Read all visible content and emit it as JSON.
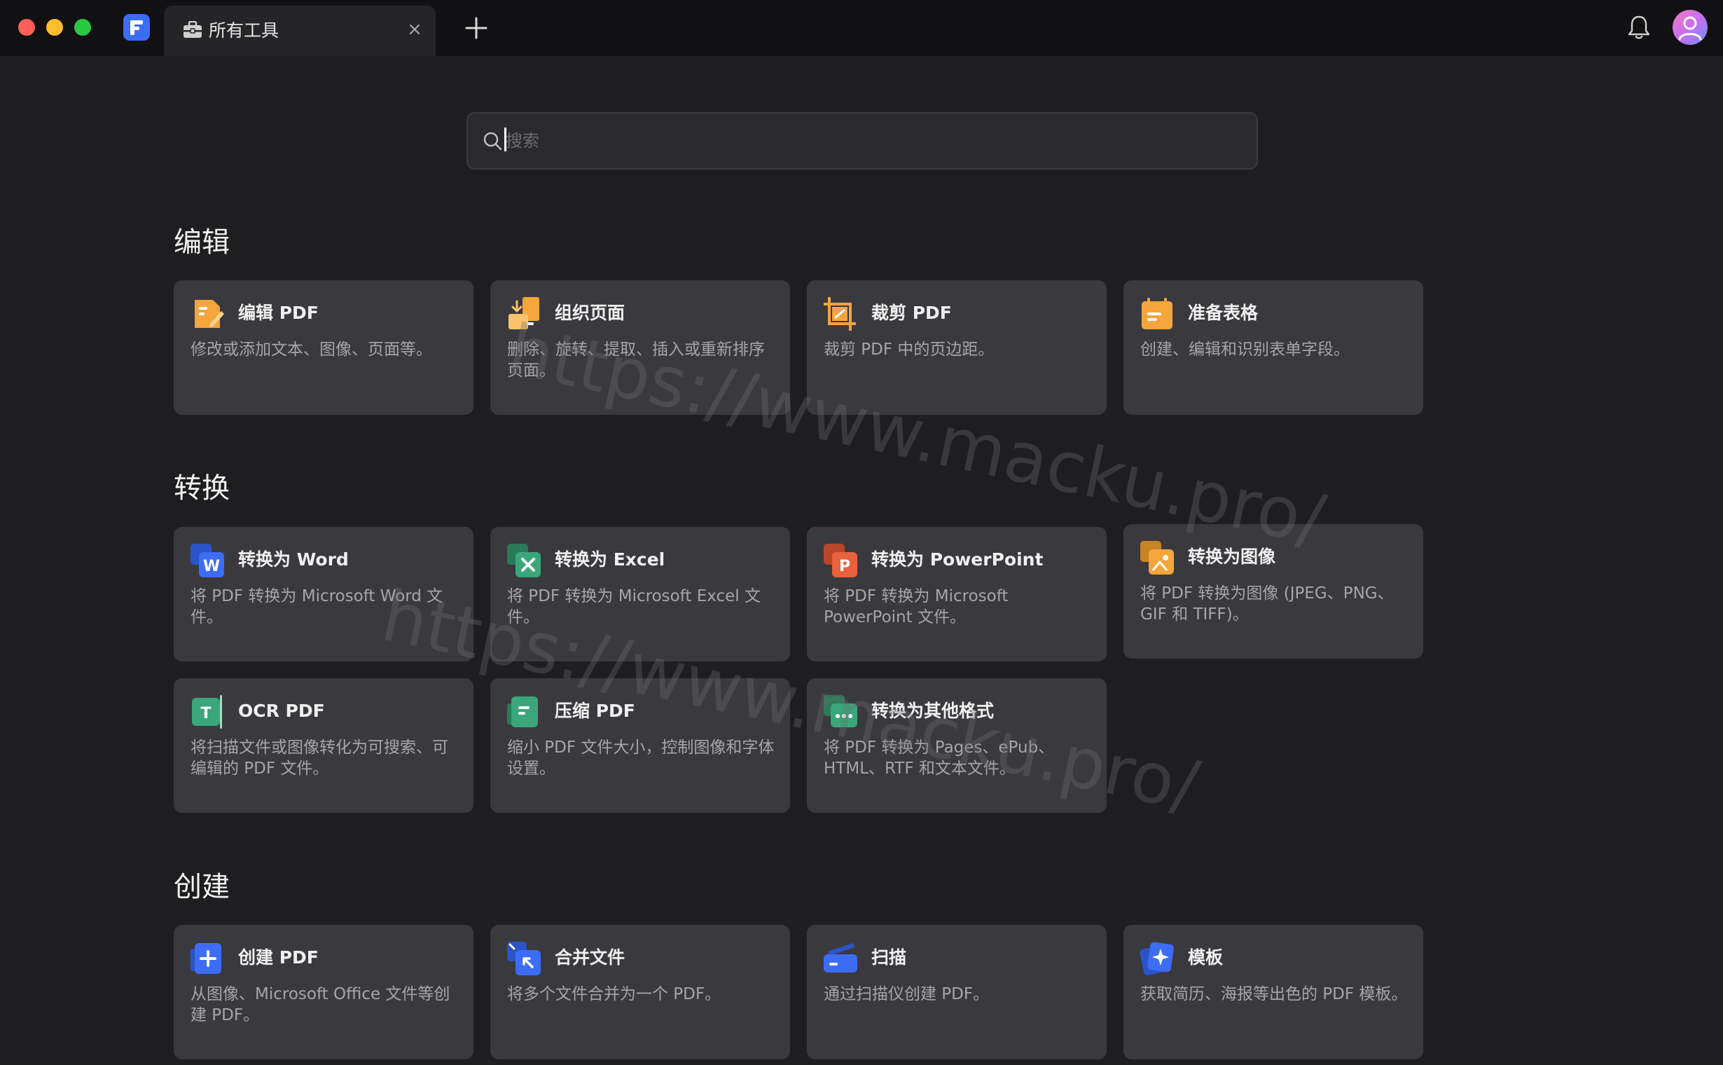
{
  "tab": {
    "title": "所有工具",
    "close": "×"
  },
  "search": {
    "placeholder": "搜索"
  },
  "sections": [
    {
      "title": "编辑",
      "cards": [
        {
          "title": "编辑 PDF",
          "desc": "修改或添加文本、图像、页面等。",
          "icon": "edit-pdf-icon",
          "color": "#f4a53c"
        },
        {
          "title": "组织页面",
          "desc": "删除、旋转、提取、插入或重新排序页面。",
          "icon": "organize-pages-icon",
          "color": "#f4a53c"
        },
        {
          "title": "裁剪 PDF",
          "desc": "裁剪 PDF 中的页边距。",
          "icon": "crop-pdf-icon",
          "color": "#f4a53c"
        },
        {
          "title": "准备表格",
          "desc": "创建、编辑和识别表单字段。",
          "icon": "prepare-form-icon",
          "color": "#f4a53c"
        }
      ]
    },
    {
      "title": "转换",
      "cards": [
        {
          "title": "转换为 Word",
          "desc": "将 PDF 转换为 Microsoft Word 文件。",
          "icon": "word-icon",
          "color": "#3d6cf5"
        },
        {
          "title": "转换为 Excel",
          "desc": "将 PDF 转换为 Microsoft Excel 文件。",
          "icon": "excel-icon",
          "color": "#3aa67a"
        },
        {
          "title": "转换为 PowerPoint",
          "desc": "将 PDF 转换为 Microsoft PowerPoint 文件。",
          "icon": "powerpoint-icon",
          "color": "#e8623c"
        },
        {
          "title": "转换为图像",
          "desc": "将 PDF 转换为图像 (JPEG、PNG、GIF 和 TIFF)。",
          "icon": "image-icon",
          "color": "#f4a53c"
        },
        {
          "title": "OCR PDF",
          "desc": "将扫描文件或图像转化为可搜索、可编辑的 PDF 文件。",
          "icon": "ocr-icon",
          "color": "#3aa67a"
        },
        {
          "title": "压缩 PDF",
          "desc": "缩小 PDF 文件大小，控制图像和字体设置。",
          "icon": "compress-icon",
          "color": "#3aa67a"
        },
        {
          "title": "转换为其他格式",
          "desc": "将 PDF 转换为 Pages、ePub、HTML、RTF 和文本文件。",
          "icon": "other-formats-icon",
          "color": "#3aa67a"
        }
      ]
    },
    {
      "title": "创建",
      "cards": [
        {
          "title": "创建 PDF",
          "desc": "从图像、Microsoft Office 文件等创建 PDF。",
          "icon": "create-pdf-icon",
          "color": "#3d6cf5"
        },
        {
          "title": "合并文件",
          "desc": "将多个文件合并为一个 PDF。",
          "icon": "merge-files-icon",
          "color": "#3d6cf5"
        },
        {
          "title": "扫描",
          "desc": "通过扫描仪创建 PDF。",
          "icon": "scan-icon",
          "color": "#3d6cf5"
        },
        {
          "title": "模板",
          "desc": "获取简历、海报等出色的 PDF 模板。",
          "icon": "template-icon",
          "color": "#3d6cf5"
        }
      ]
    }
  ],
  "watermark": {
    "text": "https://www.macku.pro/"
  }
}
